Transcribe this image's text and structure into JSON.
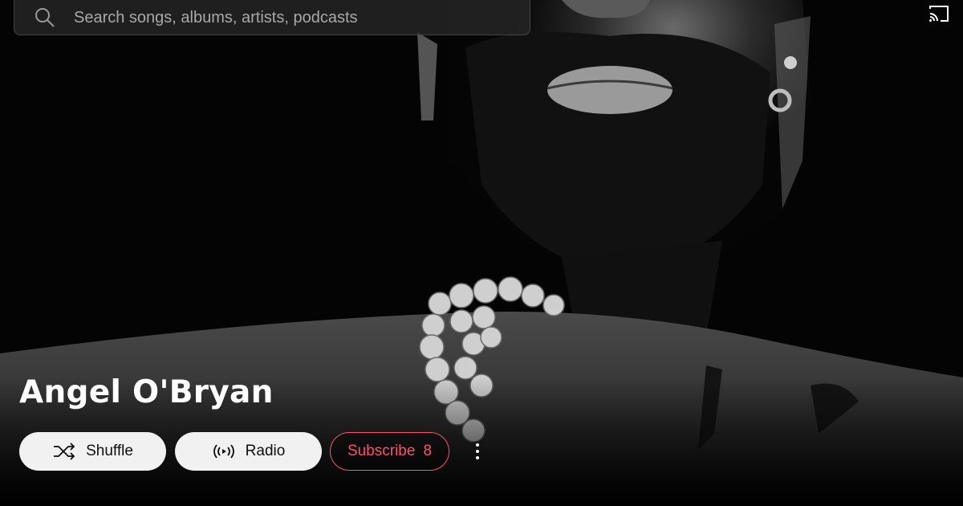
{
  "search": {
    "placeholder": "Search songs, albums, artists, podcasts"
  },
  "artist": {
    "name": "Angel O'Bryan"
  },
  "actions": {
    "shuffle_label": "Shuffle",
    "radio_label": "Radio",
    "subscribe_label": "Subscribe",
    "subscriber_count": "8"
  },
  "icons": {
    "search": "search-icon",
    "cast": "cast-icon",
    "shuffle": "shuffle-icon",
    "radio": "radio-icon",
    "more": "more-vertical-icon"
  },
  "colors": {
    "background": "#000000",
    "subscribe_accent": "#ff4e73",
    "pill_light": "#f1f1f1"
  }
}
